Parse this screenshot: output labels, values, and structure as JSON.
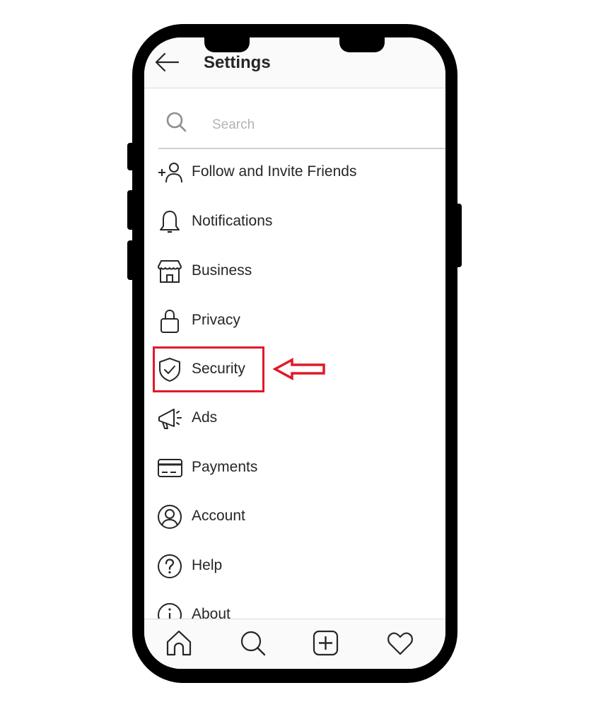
{
  "header": {
    "title": "Settings",
    "back_icon": "arrow-left-icon"
  },
  "search": {
    "placeholder": "Search",
    "icon": "search-icon"
  },
  "menu": {
    "items": [
      {
        "label": "Follow and Invite Friends",
        "icon": "add-person-icon"
      },
      {
        "label": "Notifications",
        "icon": "bell-icon"
      },
      {
        "label": "Business",
        "icon": "storefront-icon"
      },
      {
        "label": "Privacy",
        "icon": "lock-icon"
      },
      {
        "label": "Security",
        "icon": "shield-check-icon"
      },
      {
        "label": "Ads",
        "icon": "megaphone-icon"
      },
      {
        "label": "Payments",
        "icon": "credit-card-icon"
      },
      {
        "label": "Account",
        "icon": "user-circle-icon"
      },
      {
        "label": "Help",
        "icon": "help-circle-icon"
      },
      {
        "label": "About",
        "icon": "info-circle-icon"
      }
    ]
  },
  "annotation": {
    "highlighted_item": "Security",
    "highlight_color": "#e0192a"
  },
  "tabbar": {
    "tabs": [
      {
        "name": "home",
        "icon": "home-icon"
      },
      {
        "name": "search",
        "icon": "search-icon"
      },
      {
        "name": "create",
        "icon": "plus-square-icon"
      },
      {
        "name": "activity",
        "icon": "heart-icon"
      }
    ]
  },
  "colors": {
    "text": "#262626",
    "placeholder": "#b3b3b3",
    "divider": "#dbdbdb",
    "frame": "#000000"
  }
}
